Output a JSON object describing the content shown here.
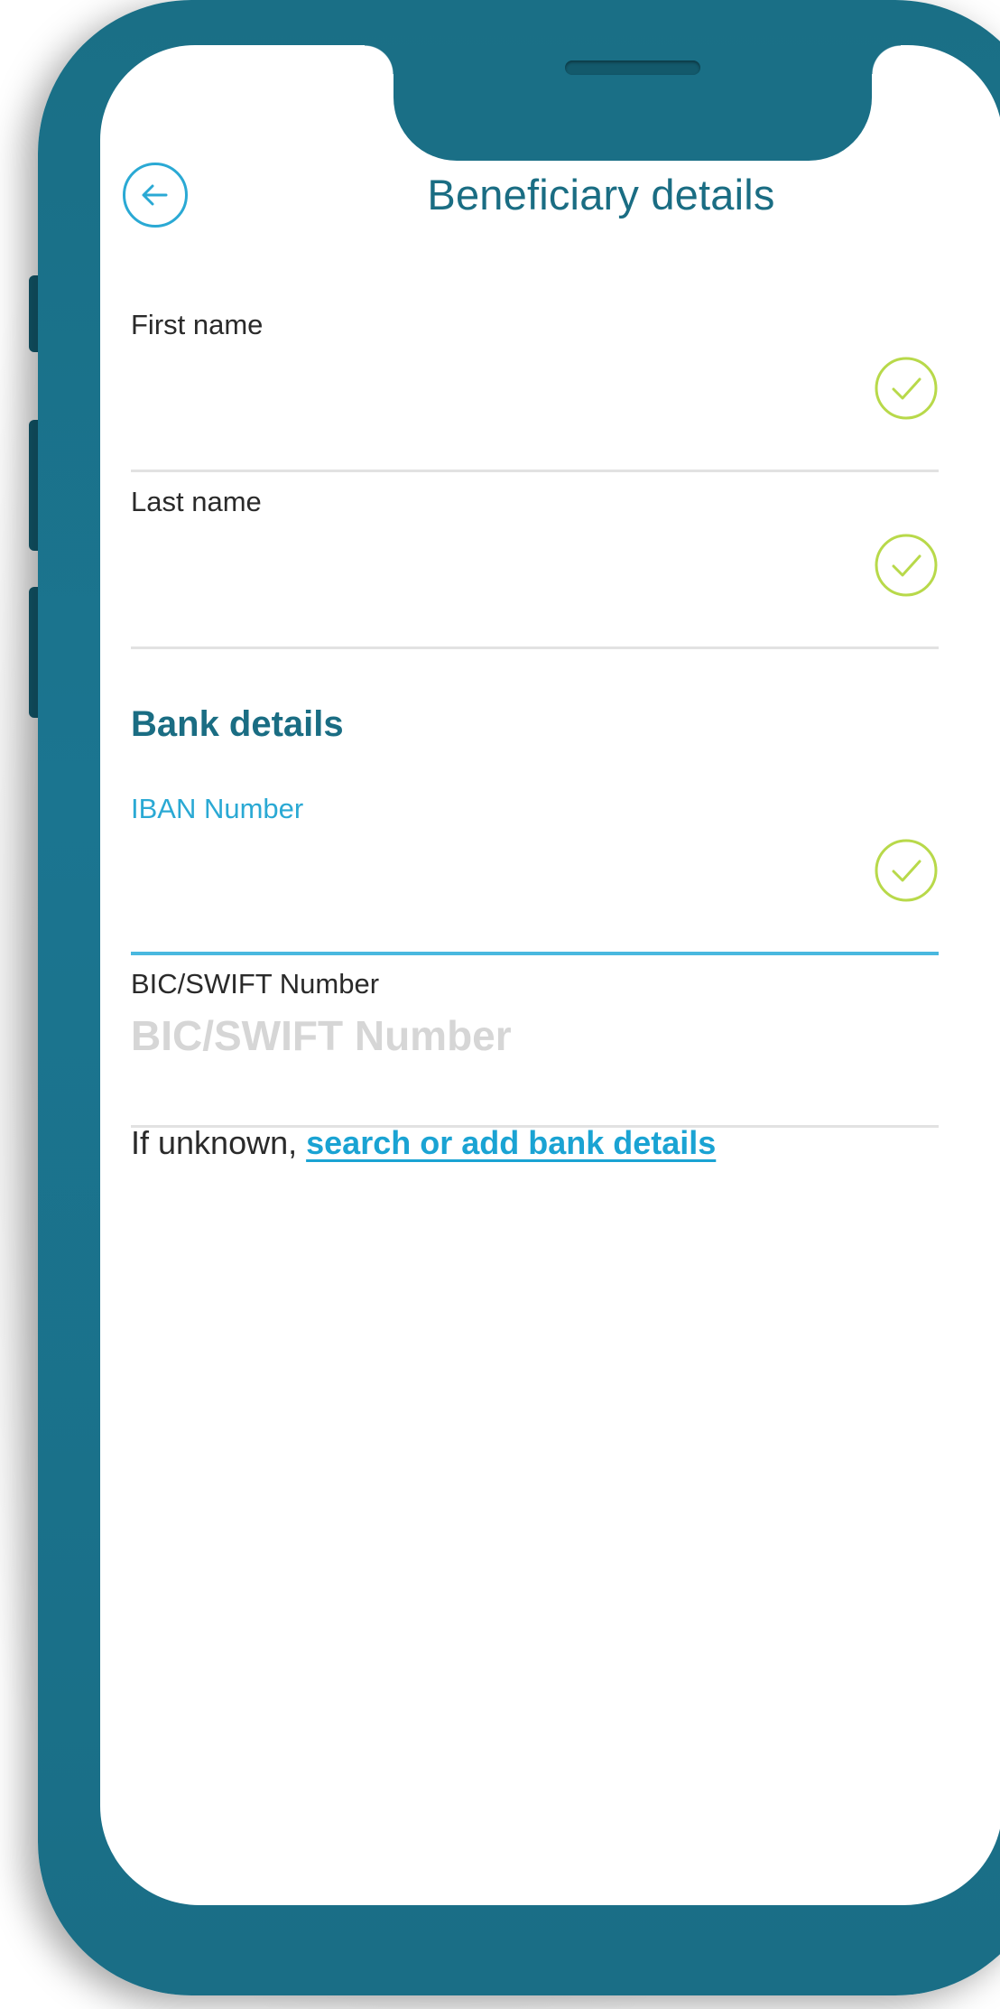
{
  "header": {
    "title": "Beneficiary details",
    "back_icon": "arrow-left-circle-icon"
  },
  "fields": {
    "first_name": {
      "label": "First name",
      "value": "",
      "status_icon": "check-circle-icon"
    },
    "last_name": {
      "label": "Last name",
      "value": "",
      "status_icon": "check-circle-icon"
    },
    "iban": {
      "label": "IBAN Number",
      "value": "",
      "status_icon": "check-circle-icon"
    },
    "bic": {
      "label": "BIC/SWIFT Number",
      "placeholder": "BIC/SWIFT Number",
      "value": ""
    }
  },
  "bank_section": {
    "title": "Bank details"
  },
  "hint": {
    "prefix": "If unknown, ",
    "link": "search or add bank details"
  },
  "colors": {
    "brand_teal": "#1a6d83",
    "accent_blue": "#2aa9d4",
    "success_green": "#b8d94a",
    "phone_body": "#1a6f86"
  }
}
